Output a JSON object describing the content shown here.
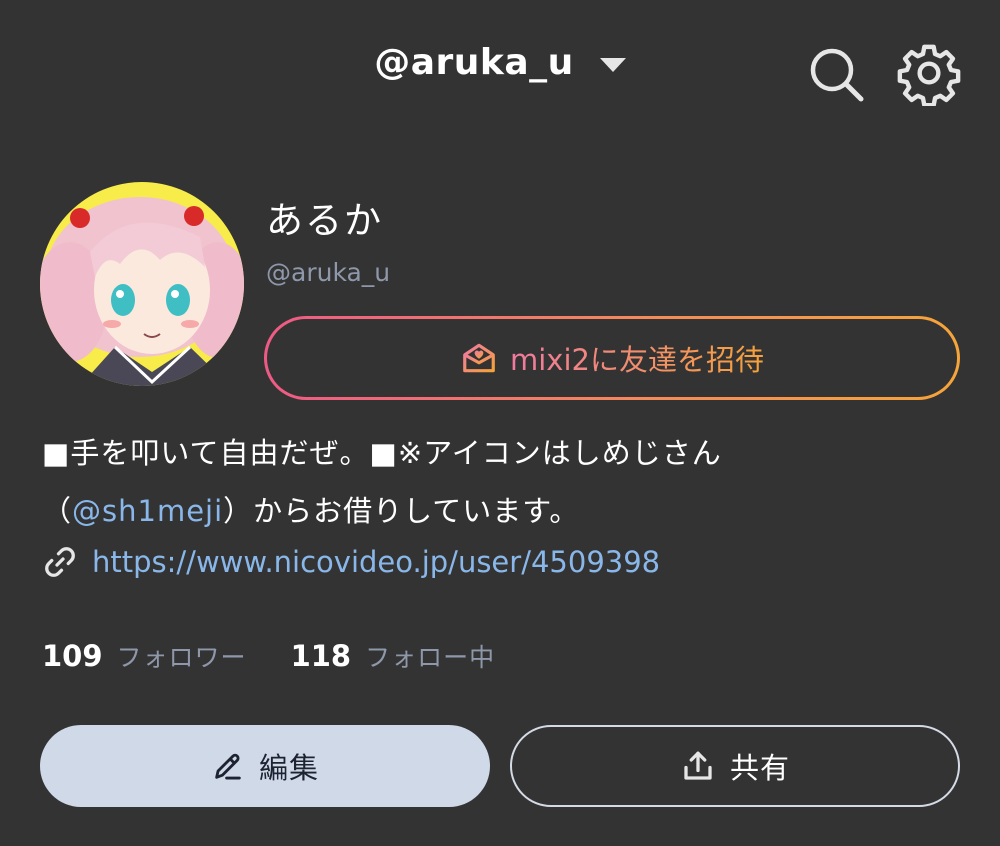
{
  "header": {
    "username": "@aruka_u"
  },
  "profile": {
    "display_name": "あるか",
    "handle": "@aruka_u",
    "invite_label": "mixi2に友達を招待",
    "bio_line1": "■手を叩いて自由だぜ。■※アイコンはしめじさん",
    "bio_line2_prefix": "（",
    "bio_mention": "@sh1meji",
    "bio_line2_suffix": "）からお借りしています。",
    "link": "https://www.nicovideo.jp/user/4509398"
  },
  "stats": {
    "followers_count": "109",
    "followers_label": "フォロワー",
    "following_count": "118",
    "following_label": "フォロー中"
  },
  "actions": {
    "edit_label": "編集",
    "share_label": "共有"
  },
  "icons": {
    "search": "search-icon",
    "settings": "gear-icon",
    "link": "link-icon",
    "invite": "envelope-heart-icon",
    "edit": "pencil-icon",
    "share": "share-upload-icon"
  },
  "colors": {
    "background": "#333333",
    "link_blue": "#8ab7ea",
    "muted": "#8e98aa",
    "invite_gradient_start": "#ee5a86",
    "invite_gradient_end": "#f5a53a",
    "edit_button_bg": "#cfd9e8"
  }
}
